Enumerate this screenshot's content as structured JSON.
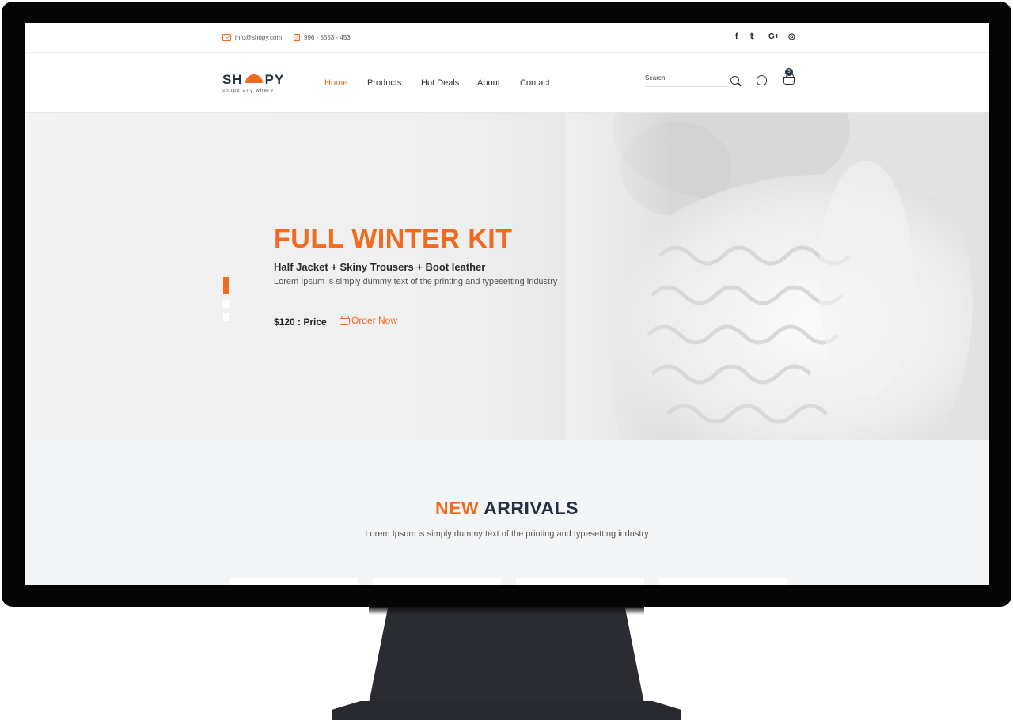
{
  "topbar": {
    "email": "info@shopy.com",
    "phone": "996 - 5553 - 453",
    "social": [
      {
        "label": "f",
        "icon": "facebook-icon"
      },
      {
        "label": "𝕥",
        "icon": "twitter-icon"
      },
      {
        "label": "G+",
        "icon": "google-plus-icon"
      },
      {
        "label": "◎",
        "icon": "instagram-icon"
      }
    ]
  },
  "header": {
    "logo": {
      "left": "SH",
      "right": "PY",
      "tagline": "shope any where"
    },
    "nav": [
      "Home",
      "Products",
      "Hot Deals",
      "About",
      "Contact"
    ],
    "active_nav": "Home",
    "search_placeholder": "Search",
    "cart_count": "5"
  },
  "hero": {
    "title": "FULL WINTER KIT",
    "subtitle": "Half Jacket + Skiny Trousers + Boot leather",
    "description": "Lorem Ipsum is simply dummy text of the printing and typesetting industry",
    "price": "$120 : Price",
    "order_label": "Order Now",
    "slides_total": 3,
    "active_slide": 1
  },
  "arrivals": {
    "title_accent": "NEW",
    "title_rest": "ARRIVALS",
    "description": "Lorem Ipsum is simply dummy text of the printing and typesetting industry"
  },
  "colors": {
    "accent": "#f06a1f",
    "dark": "#253142"
  }
}
